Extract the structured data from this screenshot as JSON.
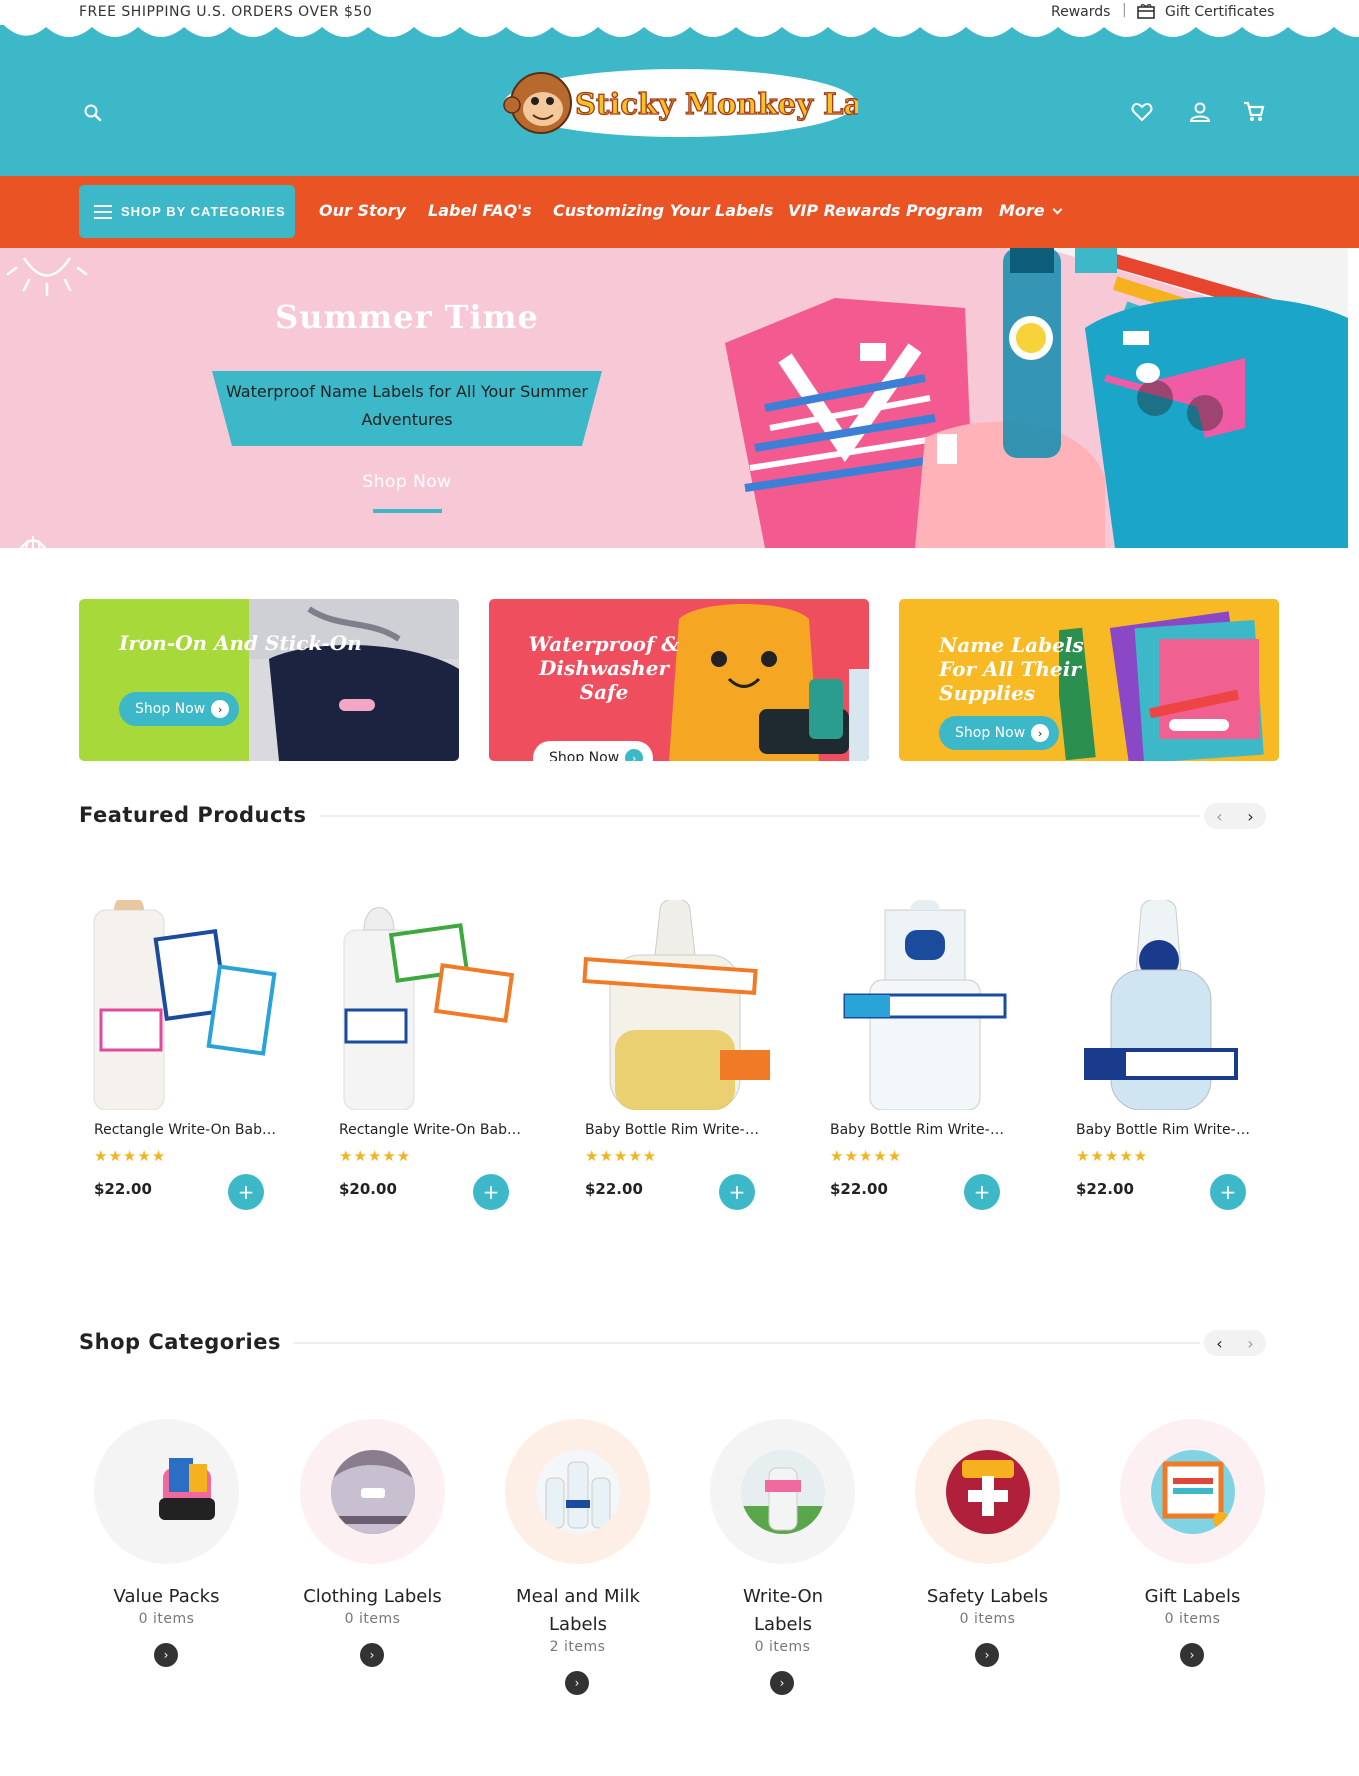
{
  "topbar": {
    "shipping": "FREE SHIPPING U.S. ORDERS OVER $50",
    "rewards": "Rewards",
    "gift": "Gift Certificates"
  },
  "brand": {
    "logo_text": "Sticky Monkey Labels"
  },
  "nav": {
    "shop_by": "SHOP BY CATEGORIES",
    "links": [
      "Our Story",
      "Label FAQ's",
      "Customizing Your Labels",
      "VIP Rewards Program",
      "More"
    ]
  },
  "hero": {
    "title": "Summer Time",
    "subtitle": "Waterproof Name Labels for All Your Summer Adventures",
    "cta": "Shop Now"
  },
  "promos": [
    {
      "title": "Iron-On And Stick-On",
      "cta": "Shop Now"
    },
    {
      "title": "Waterproof & Dishwasher Safe",
      "cta": "Shop Now"
    },
    {
      "title": "Name Labels For All Their Supplies",
      "cta": "Shop Now"
    }
  ],
  "featured": {
    "title": "Featured Products",
    "products": [
      {
        "name": "Rectangle Write-On Baby Bottle Labels",
        "rating": "★★★★★",
        "price": "$22.00"
      },
      {
        "name": "Rectangle Write-On Baby Bottle Labels",
        "rating": "★★★★★",
        "price": "$20.00"
      },
      {
        "name": "Baby Bottle Rim Write-On Labels",
        "rating": "★★★★★",
        "price": "$22.00"
      },
      {
        "name": "Baby Bottle Rim Write-On Labels",
        "rating": "★★★★★",
        "price": "$22.00"
      },
      {
        "name": "Baby Bottle Rim Write-On Labels",
        "rating": "★★★★★",
        "price": "$22.00"
      }
    ]
  },
  "categories": {
    "title": "Shop Categories",
    "items": [
      {
        "name": "Value Packs",
        "count": "0 items"
      },
      {
        "name": "Clothing Labels",
        "count": "0 items"
      },
      {
        "name": "Meal and Milk Labels",
        "count": "2 items"
      },
      {
        "name": "Write-On Labels",
        "count": "0 items"
      },
      {
        "name": "Safety Labels",
        "count": "0 items"
      },
      {
        "name": "Gift Labels",
        "count": "0 items"
      }
    ]
  },
  "colors": {
    "teal": "#3cb8c9",
    "orange": "#ea5425",
    "pink": "#f7c9d6",
    "star": "#f5b21e"
  },
  "icons": [
    "search-icon",
    "heart-icon",
    "account-icon",
    "cart-icon",
    "gift-icon",
    "menu-icon",
    "chevron-down-icon",
    "arrow-right-icon",
    "plus-icon",
    "chevron-left-icon",
    "chevron-right-icon"
  ]
}
